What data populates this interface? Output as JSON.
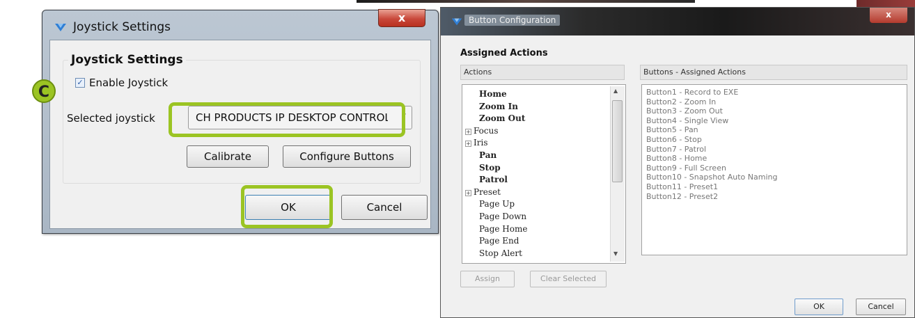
{
  "annotation": {
    "badge_letter": "C",
    "highlight_color": "#9bc423"
  },
  "joystick_dialog": {
    "title": "Joystick Settings",
    "close_glyph": "x",
    "group_title": "Joystick Settings",
    "enable_label": "Enable Joystick",
    "enable_checked": true,
    "checkbox_glyph": "✓",
    "selected_label": "Selected joystick",
    "selected_value": "CH PRODUCTS IP DESKTOP CONTROLLER",
    "combo_arrow": "▾",
    "calibrate_label": "Calibrate",
    "configure_label": "Configure Buttons",
    "ok_label": "OK",
    "cancel_label": "Cancel"
  },
  "button_config_dialog": {
    "title": "Button Configuration",
    "close_glyph": "x",
    "assigned_title": "Assigned Actions",
    "actions_header": "Actions",
    "buttons_header": "Buttons - Assigned Actions",
    "actions": [
      {
        "label": "Home",
        "bold": true,
        "expandable": false
      },
      {
        "label": "Zoom In",
        "bold": true,
        "expandable": false
      },
      {
        "label": "Zoom Out",
        "bold": true,
        "expandable": false
      },
      {
        "label": "Focus",
        "bold": false,
        "expandable": true
      },
      {
        "label": "Iris",
        "bold": false,
        "expandable": true
      },
      {
        "label": "Pan",
        "bold": true,
        "expandable": false
      },
      {
        "label": "Stop",
        "bold": true,
        "expandable": false
      },
      {
        "label": "Patrol",
        "bold": true,
        "expandable": false
      },
      {
        "label": "Preset",
        "bold": false,
        "expandable": true
      },
      {
        "label": "Page Up",
        "bold": false,
        "expandable": false
      },
      {
        "label": "Page Down",
        "bold": false,
        "expandable": false
      },
      {
        "label": "Page Home",
        "bold": false,
        "expandable": false
      },
      {
        "label": "Page End",
        "bold": false,
        "expandable": false
      },
      {
        "label": "Stop Alert",
        "bold": false,
        "expandable": false
      }
    ],
    "assigned": [
      "Button1  - Record to EXE",
      "Button2  - Zoom In",
      "Button3  - Zoom Out",
      "Button4  - Single View",
      "Button5  - Pan",
      "Button6  - Stop",
      "Button7  - Patrol",
      "Button8  - Home",
      "Button9  - Full Screen",
      "Button10 - Snapshot Auto Naming",
      "Button11 - Preset1",
      "Button12 - Preset2"
    ],
    "assign_label": "Assign",
    "clear_label": "Clear Selected",
    "ok_label": "OK",
    "cancel_label": "Cancel"
  }
}
